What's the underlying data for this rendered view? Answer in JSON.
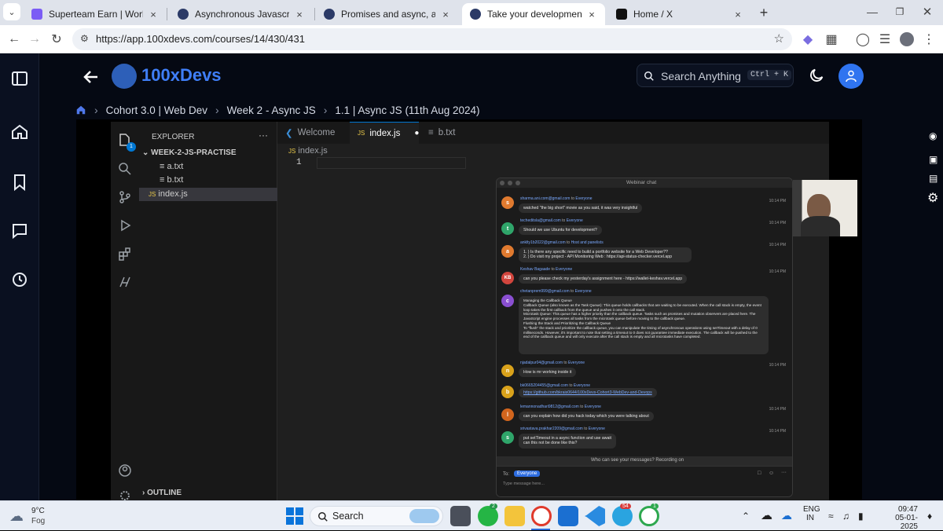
{
  "browser": {
    "tabs": [
      {
        "title": "Superteam Earn | Work to Earn",
        "close": "×"
      },
      {
        "title": "Asynchronous Javascript, Callba",
        "close": "×"
      },
      {
        "title": "Promises and async, await",
        "close": "×"
      },
      {
        "title": "Take your development skills fr",
        "close": "×"
      },
      {
        "title": "Home / X",
        "close": "×"
      }
    ],
    "url": "https://app.100xdevs.com/courses/14/430/431"
  },
  "app": {
    "brand": "100xDevs",
    "search_placeholder": "Search Anything",
    "search_shortcut": "Ctrl + K",
    "breadcrumb": [
      "Cohort 3.0 | Web Dev",
      "Week 2 - Async JS",
      "1.1 | Async JS (11th Aug 2024)"
    ]
  },
  "vscode": {
    "explorer_title": "EXPLORER",
    "folder": "WEEK-2-JS-PRACTISE",
    "files": [
      "a.txt",
      "b.txt",
      "index.js"
    ],
    "outline": "OUTLINE",
    "tabs": [
      "Welcome",
      "index.js",
      "b.txt"
    ],
    "js_badge": "JS",
    "breadcrumb_file": "index.js",
    "line_number": "1",
    "badge_count": "1"
  },
  "chat": {
    "title": "Webinar chat",
    "messages": [
      {
        "avatar": "s",
        "color": "#e07a2f",
        "sender": "sharma.ani.com@gmail.com",
        "to": "Everyone",
        "time": "10:14 PM",
        "text": "watched \"the big short\" movie as you said, it was very insightful"
      },
      {
        "avatar": "t",
        "color": "#2fa56a",
        "sender": "techeditsla@gmail.com",
        "to": "Everyone",
        "time": "10:14 PM",
        "text": "Should we use Ubuntu for development?"
      },
      {
        "avatar": "a",
        "color": "#e07a2f",
        "sender": "anklty1b2022@gmail.com",
        "to": "Host and panelists",
        "time": "10:14 PM",
        "text": "1. ) Is there any specific need to build a portfolio website for a Web Developer??\n2. ) Do visit my project - API Monitoring Web : https://api-status-checker.vercel.app"
      },
      {
        "avatar": "KB",
        "color": "#d2453d",
        "sender": "Keshav Bagaade",
        "to": "Everyone",
        "time": "10:14 PM",
        "text": "can you please check my yesterday's assignment here - https://wallet-keshav.vercel.app"
      },
      {
        "avatar": "c",
        "color": "#8a4fd1",
        "sender": "chetanprem999@gmail.com",
        "to": "Everyone",
        "time": "10:14 PM",
        "text": "Managing the Callback Queue\nCallback Queue (also known as the Task Queue): This queue holds callbacks that are waiting to be executed. When the call stack is empty, the event loop takes the first callback from the queue and pushes it onto the call stack.\nMicrotask Queue: This queue has a higher priority than the callback queue. Tasks such as promises and mutation observers are placed here. The JavaScript engine processes all tasks from the microtask queue before moving to the callback queue.\nFlushing the Stack and Prioritizing the Callback Queue\nTo \"flush\" the stack and prioritize the callback queue, you can manipulate the timing of asynchronous operations using setTimeout with a delay of 0 milliseconds. However, it's important to note that setting a timeout to 0 does not guarantee immediate execution. The callback will be pushed to the end of the callback queue and will only execute after the call stack is empty and all microtasks have completed."
      },
      {
        "avatar": "n",
        "color": "#d9a21b",
        "sender": "njadalpur04@gmail.com",
        "to": "Everyone",
        "time": "10:14 PM",
        "text": "How is mr working inside it"
      },
      {
        "avatar": "b",
        "color": "#d9a21b",
        "sender": "bk0665204455@gmail.com",
        "to": "Everyone",
        "time": "10:14 PM",
        "text": "https://github.com/bkrais0644/100xDevs-Cohort3-WebDev-and-Devops"
      },
      {
        "avatar": "l",
        "color": "#d2651d",
        "sender": "lemannonadhari9812@gmail.com",
        "to": "Everyone",
        "time": "10:14 PM",
        "text": "can you explain how did you hack today which you were talking about"
      },
      {
        "avatar": "s",
        "color": "#2fa56a",
        "sender": "srivastava.prakhar2209@gmail.com",
        "to": "Everyone",
        "time": "10:14 PM",
        "text": "put setTimeout in a async function and use await\ncan this not be done like this?"
      }
    ],
    "notice": "Who can see your messages? Recording on",
    "to_label": "To:",
    "to_value": "Everyone",
    "input_placeholder": "Type message here..."
  },
  "taskbar": {
    "weather_temp": "9°C",
    "weather_desc": "Fog",
    "search": "Search",
    "lang1": "ENG",
    "lang2": "IN",
    "time": "09:47",
    "date": "05-01-2025",
    "badge_whatsapp": "2",
    "badge_telegram": "54",
    "badge_chrome": "1"
  }
}
